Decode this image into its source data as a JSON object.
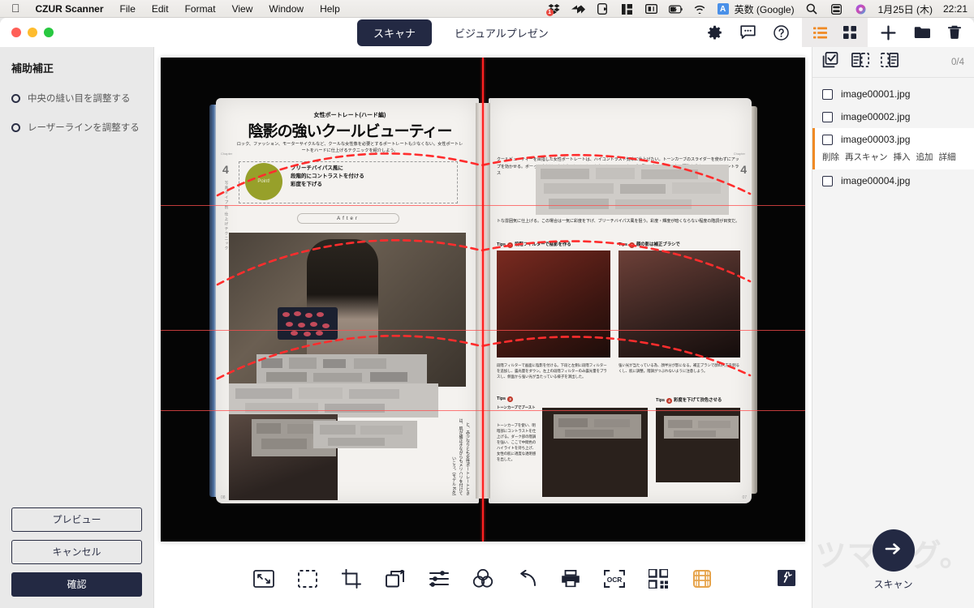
{
  "menubar": {
    "apple": "apple-logo",
    "app_name": "CZUR Scanner",
    "items": [
      "File",
      "Edit",
      "Format",
      "View",
      "Window",
      "Help"
    ],
    "status_icons": [
      {
        "name": "dropbox-icon",
        "badge": "1"
      },
      {
        "name": "fast-forward-icon",
        "badge": ""
      },
      {
        "name": "clipboard-icon",
        "badge": ""
      },
      {
        "name": "layout-icon",
        "badge": ""
      },
      {
        "name": "display-icon",
        "badge": ""
      },
      {
        "name": "battery-icon",
        "badge": ""
      },
      {
        "name": "wifi-icon",
        "badge": ""
      }
    ],
    "ime_badge": "A",
    "ime_label": "英数 (Google)",
    "search_icon": "search-icon",
    "controlcenter_icon": "control-center-icon",
    "siri_icon": "siri-icon",
    "date": "1月25日 (木)",
    "time": "22:21"
  },
  "titlebar": {
    "tabs": [
      {
        "label": "スキャナ",
        "active": true
      },
      {
        "label": "ビジュアルプレゼン",
        "active": false
      }
    ],
    "icons": [
      "gear-icon",
      "chat-icon",
      "help-icon"
    ],
    "panel_icons": [
      "list-view-icon",
      "grid-view-icon"
    ],
    "action_icons": [
      "add-icon",
      "folder-icon",
      "trash-icon"
    ],
    "accent_orange": "#f08a24",
    "accent_navy": "#232943"
  },
  "sidebar": {
    "title": "補助補正",
    "options": [
      {
        "label": "中央の縫い目を調整する",
        "selected": false
      },
      {
        "label": "レーザーラインを調整する",
        "selected": false
      }
    ],
    "buttons": [
      {
        "label": "プレビュー",
        "style": "outline"
      },
      {
        "label": "キャンセル",
        "style": "outline"
      },
      {
        "label": "確認",
        "style": "primary"
      }
    ]
  },
  "preview": {
    "book": {
      "left_page": {
        "header_sub": "女性ポートレート(ハード編)",
        "header_title": "陰影の強いクールビューティー",
        "lead": "ロック、ファッション、モーターサイクルなど、クールな女性像を必要とするポートレートも少なくない。女性ポートレートをハードに仕上げるテクニックを紹介しよう。",
        "chapter_tag": "Chapter",
        "chapter_num": "4",
        "chapter_side": "写真タイプ別 仕上げテクニック",
        "point_circle": "Point!",
        "point_lines": [
          "ブリーチバイパス風に",
          "段階的にコントラストを付ける",
          "彩度を下げる"
        ],
        "after_label": "After",
        "caption": "と、赤少なりとも女性ポートレートときは、肌が補正きながらもメリハリを付けていこう。(モデル:Kuy)",
        "folio": "08"
      },
      "right_page": {
        "lead": "クールビューティーを目指した女性ポートレートは、ハイコントラスト気味に仕上げたい。トーンカーブのスライダーを使わずにアップを効かせる。ボーっと向だけにおさえて切るくしても良いし、トーンカーブで引くブーストするあー明瞭を落ちつつ、ハイコントラス",
        "lead2": "トな雰囲気に仕上げる。この場合は一気に彩度を下げ、ブリーチバイパス風を狙う。彩度・輝度が暗くならない程度の階調が目安だ。",
        "tips": [
          {
            "num": "1",
            "title": "段階フィルターで陰影を作る",
            "caption": "段階フィルターで画面に陰影を付ける。下段と左側に段階フィルターを追加し、露光量をダウン。左上の段階フィルターのみ露光量をプラスし、側面から強い光が当たっている様子を演出した。"
          },
          {
            "num": "2",
            "title": "顔の影は補正ブラシで",
            "caption": "強い光が当たっている為、顔半分が影になる。補正ブラシで顔の片方を明るくし、肌に調整。階調がつぶれないように注意しよう。"
          },
          {
            "num": "3",
            "title": "トーンカーブでブースト",
            "caption": "トーンカーブを使い、明暗部にコントラストを仕上げる。ダーク部の階調を強い、ここで中間色のハイライトを持ち上げ、女性の肌に適度な透明感を出した。"
          },
          {
            "num": "4",
            "title": "彩度を下げて渋色させる",
            "caption": ""
          }
        ],
        "chapter_tag": "Chapter",
        "chapter_num": "4",
        "folio": "07"
      }
    },
    "guides": {
      "laser_color": "#ff2020",
      "curve_color": "#ff2d2d",
      "vertical_line_x_percent": 50,
      "horizontal_lines": [
        3,
        5
      ],
      "curve_count": 4
    }
  },
  "toolbar": {
    "tools": [
      {
        "name": "fit-screen-icon",
        "label": "フィット"
      },
      {
        "name": "selection-icon",
        "label": "選択"
      },
      {
        "name": "crop-icon",
        "label": "トリミング"
      },
      {
        "name": "rotate-icon",
        "label": "回転"
      },
      {
        "name": "adjust-icon",
        "label": "調整"
      },
      {
        "name": "color-icon",
        "label": "カラー"
      },
      {
        "name": "undo-icon",
        "label": "元に戻す"
      },
      {
        "name": "print-icon",
        "label": "印刷"
      },
      {
        "name": "ocr-icon",
        "label": "OCR"
      },
      {
        "name": "qrcode-icon",
        "label": "QRコード"
      },
      {
        "name": "table-icon",
        "label": "表"
      }
    ],
    "corner_icon": "image-broken-icon"
  },
  "right_panel": {
    "head_icons": [
      "select-all-icon",
      "select-odd-icon",
      "select-even-icon"
    ],
    "count": "0/4",
    "files": [
      {
        "name": "image00001.jpg",
        "checked": false,
        "selected": false
      },
      {
        "name": "image00002.jpg",
        "checked": false,
        "selected": false
      },
      {
        "name": "image00003.jpg",
        "checked": false,
        "selected": true
      },
      {
        "name": "image00004.jpg",
        "checked": false,
        "selected": false
      }
    ],
    "row_actions": [
      "削除",
      "再スキャン",
      "挿入",
      "追加",
      "詳細"
    ],
    "watermark": "ツマナグ。",
    "scan_label": "スキャン",
    "scan_icon": "scan-arrow-icon"
  }
}
